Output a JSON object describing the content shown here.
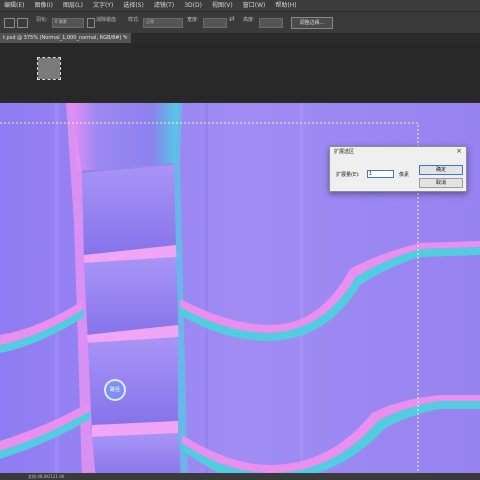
{
  "menubar": {
    "items": [
      "编辑(E)",
      "图像(I)",
      "图层(L)",
      "文字(Y)",
      "选择(S)",
      "滤镜(T)",
      "3D(D)",
      "视图(V)",
      "窗口(W)",
      "帮助(H)"
    ]
  },
  "options": {
    "feather_label": "羽化:",
    "feather_value": "0 像素",
    "antialias_label": "消除锯齿",
    "style_label": "样式:",
    "style_value": "正常",
    "width_label": "宽度:",
    "height_label": "高度:",
    "refine_button": "调整边缘..."
  },
  "document_tab": {
    "title": "t.psd @ 375% (Normal_1,000_normal, RGB/8#) *",
    "close": "×"
  },
  "dialog": {
    "title": "扩展选区",
    "close": "×",
    "expand_label": "扩展量(E):",
    "expand_value": "1",
    "unit": "像素",
    "ok_label": "确定",
    "cancel_label": "取消"
  },
  "cursor": {
    "label": "路径"
  },
  "status": {
    "text": "文档:48.0K/121.0K"
  },
  "colors": {
    "canvas_base": "#9f88f0",
    "pink_edge": "#e88ff0",
    "cyan_edge": "#4fd0dc"
  }
}
